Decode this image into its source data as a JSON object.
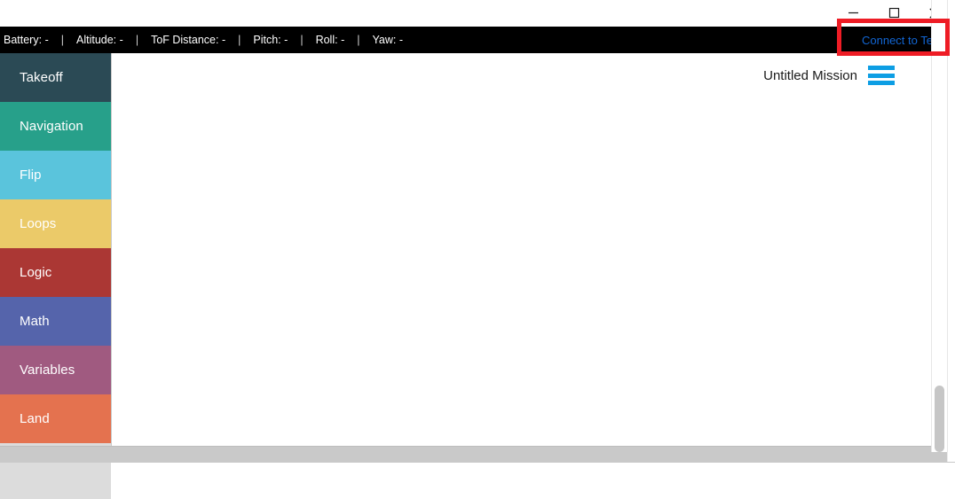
{
  "window": {
    "controls": [
      {
        "name": "minimize",
        "glyph": "minimize-icon"
      },
      {
        "name": "maximize",
        "glyph": "maximize-icon"
      },
      {
        "name": "close",
        "glyph": "close-icon"
      }
    ]
  },
  "status_bar": {
    "background": "#000000",
    "telemetry": [
      {
        "label": "Battery:",
        "value": "-"
      },
      {
        "label": "Altitude:",
        "value": "-"
      },
      {
        "label": "ToF Distance:",
        "value": "-"
      },
      {
        "label": "Pitch:",
        "value": "-"
      },
      {
        "label": "Roll:",
        "value": "-"
      },
      {
        "label": "Yaw:",
        "value": "-"
      }
    ],
    "separator": "|",
    "connect_label": "Connect to Tello",
    "connect_color": "#1266d4"
  },
  "annotation": {
    "highlight_color": "#ee1c25",
    "target": "Connect to Tello"
  },
  "sidebar": {
    "items": [
      {
        "label": "Takeoff",
        "color": "#2b4a55"
      },
      {
        "label": "Navigation",
        "color": "#27a08a"
      },
      {
        "label": "Flip",
        "color": "#5ac4dc"
      },
      {
        "label": "Loops",
        "color": "#ebca69"
      },
      {
        "label": "Logic",
        "color": "#ab3734"
      },
      {
        "label": "Math",
        "color": "#5564ab"
      },
      {
        "label": "Variables",
        "color": "#a05a80"
      },
      {
        "label": "Land",
        "color": "#e4724f"
      }
    ]
  },
  "workspace": {
    "mission_name": "Untitled Mission",
    "menu_icon": "hamburger-menu-icon",
    "menu_icon_color": "#0d9ee4",
    "background": "#ffffff"
  }
}
